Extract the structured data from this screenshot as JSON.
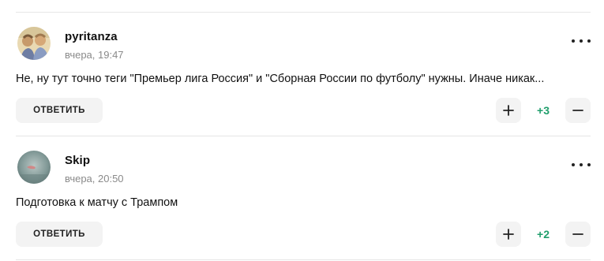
{
  "comments": [
    {
      "author": "pyritanza",
      "time": "вчера, 19:47",
      "text": "Не, ну тут точно теги \"Премьер лига Россия\" и \"Сборная России по футболу\" нужны. Иначе никак...",
      "reply_label": "ОТВЕТИТЬ",
      "score": "+3"
    },
    {
      "author": "Skip",
      "time": "вчера, 20:50",
      "text": "Подготовка к матчу с Трампом",
      "reply_label": "ОТВЕТИТЬ",
      "score": "+2"
    }
  ],
  "icons": {
    "more": "more-horizontal-icon",
    "upvote": "plus-icon",
    "downvote": "minus-icon"
  },
  "colors": {
    "score_positive": "#1f9e6b",
    "button_bg": "#f3f3f3",
    "muted_text": "#8a8a8a"
  }
}
